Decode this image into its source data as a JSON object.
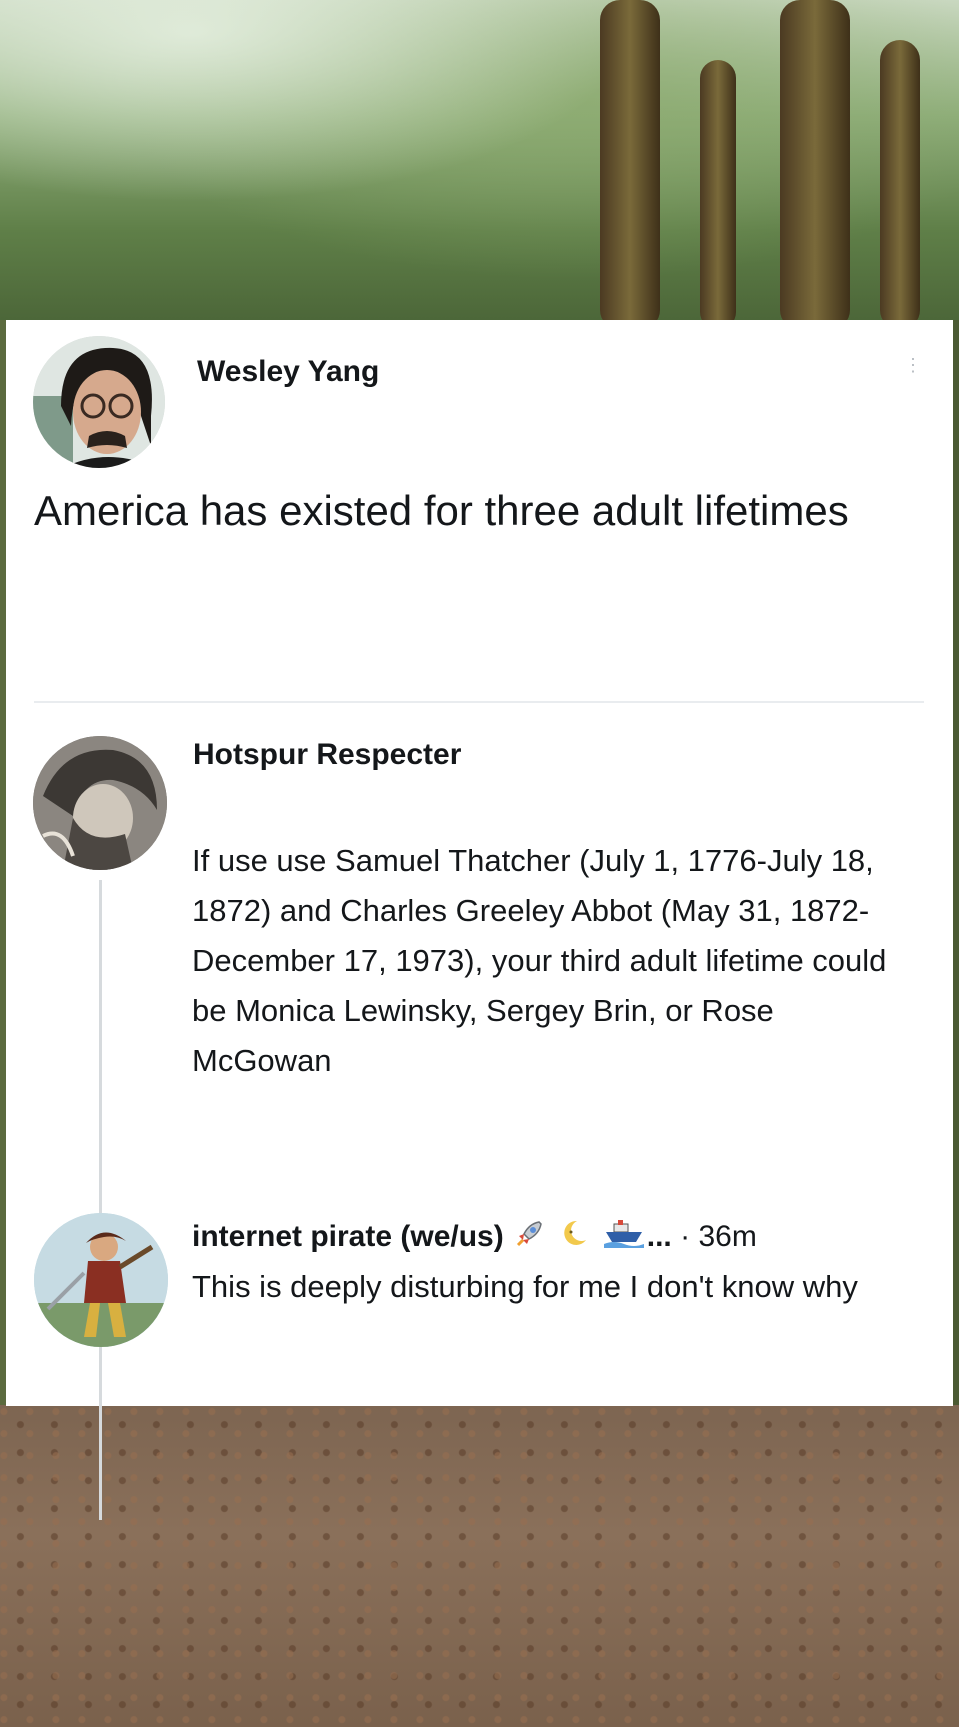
{
  "original_post": {
    "author": "Wesley Yang",
    "text": "America has existed for three adult lifetimes"
  },
  "reply": {
    "author": "Hotspur Respecter",
    "text": "If use use Samuel Thatcher (July 1, 1776-July 18, 1872) and Charles Greeley Abbot (May 31, 1872-December 17, 1973), your third adult lifetime could be Monica Lewinsky, Sergey Brin, or Rose McGowan"
  },
  "second_reply": {
    "author": "internet pirate (we/us)",
    "emoji_icons": [
      "rocket-icon",
      "crescent-moon-icon",
      "ship-icon"
    ],
    "ellipsis": "...",
    "separator": "·",
    "time": "36m",
    "text": "This is deeply disturbing for me I don't know why"
  }
}
